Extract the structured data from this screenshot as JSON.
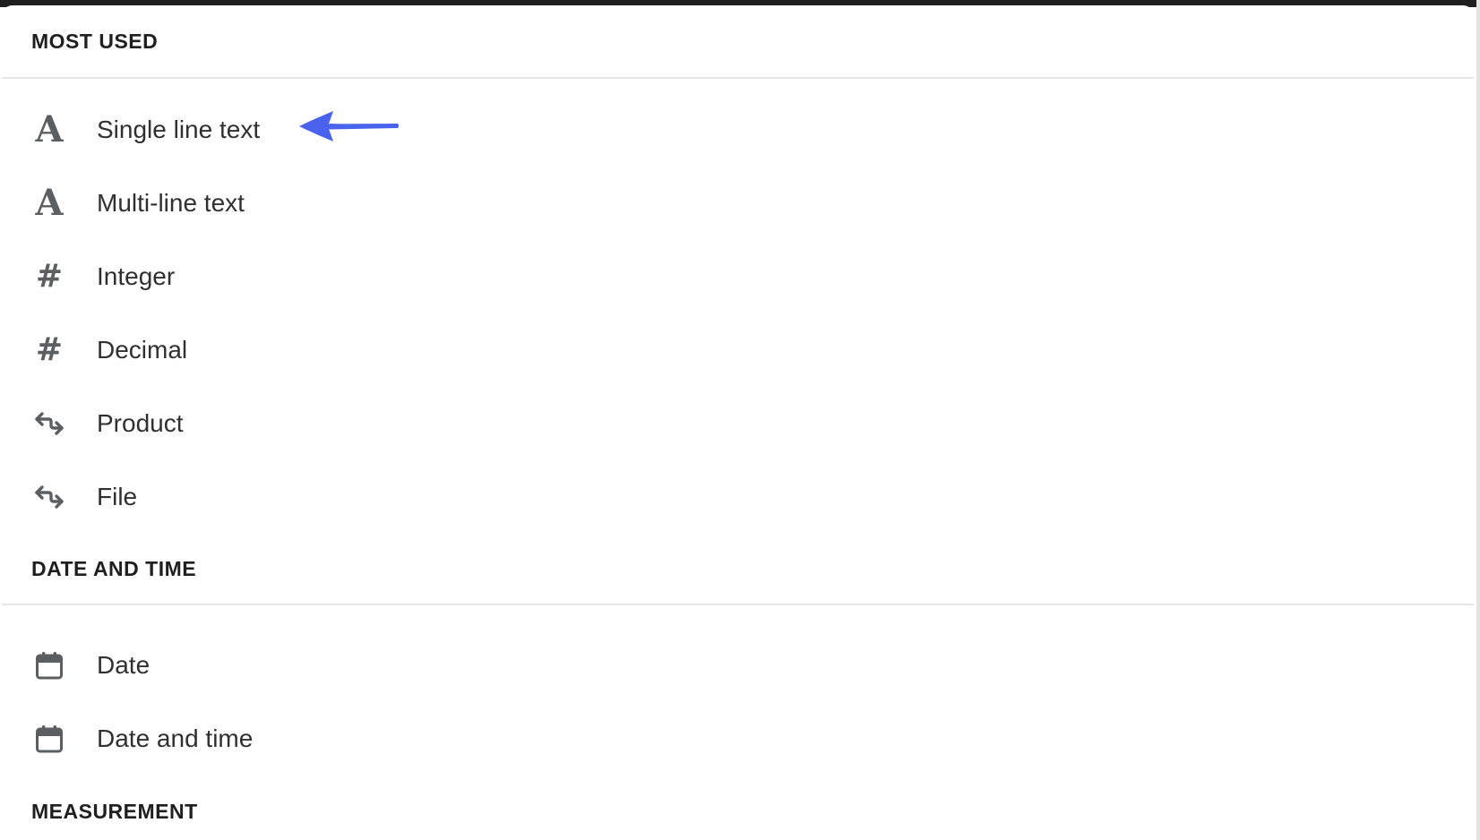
{
  "sections": [
    {
      "title": "MOST USED",
      "items": [
        {
          "label": "Single line text",
          "icon": "text-icon"
        },
        {
          "label": "Multi-line text",
          "icon": "text-icon"
        },
        {
          "label": "Integer",
          "icon": "hash-icon"
        },
        {
          "label": "Decimal",
          "icon": "hash-icon"
        },
        {
          "label": "Product",
          "icon": "reference-arrows-icon"
        },
        {
          "label": "File",
          "icon": "reference-arrows-icon"
        }
      ]
    },
    {
      "title": "DATE AND TIME",
      "items": [
        {
          "label": "Date",
          "icon": "calendar-icon"
        },
        {
          "label": "Date and time",
          "icon": "calendar-icon"
        }
      ]
    },
    {
      "title": "MEASUREMENT",
      "items": []
    }
  ],
  "colors": {
    "icon": "#5c5f62",
    "text": "#303030",
    "header": "#1f1f1f",
    "divider": "#e6e6e6",
    "annotation_arrow": "#4a63ee"
  }
}
